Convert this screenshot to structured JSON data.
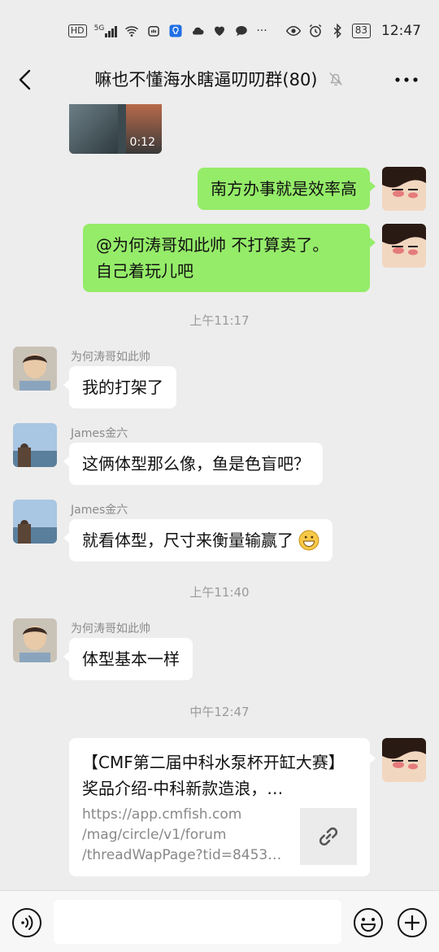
{
  "status_bar": {
    "network": "HD",
    "signal": "5G",
    "battery": "83",
    "time": "12:47"
  },
  "nav": {
    "title": "嘛也不懂海水瞎逼叨叨群(80)",
    "back_icon": "chevron-left-icon",
    "mute_icon": "bell-off-icon",
    "more_icon": "more-horizontal-icon"
  },
  "messages": {
    "video_duration": "0:12",
    "m1": "南方办事就是效率高",
    "m2_line1": "@为何涛哥如此帅  不打算卖了。",
    "m2_line2": "自己着玩儿吧",
    "ts1": "上午11:17",
    "s1": "为何涛哥如此帅",
    "m3": "我的打架了",
    "s2": "James金六",
    "m4": "这俩体型那么像，鱼是色盲吧？",
    "s3": "James金六",
    "m5": "就看体型，尺寸来衡量输赢了",
    "ts2": "上午11:40",
    "s4": "为何涛哥如此帅",
    "m6": "体型基本一样",
    "ts3": "中午12:47"
  },
  "link_card": {
    "title": "【CMF第二届中科水泵杯开缸大赛】奖品介绍-中科新款造浪，…",
    "desc_line1": "https://app.cmfish.com",
    "desc_line2": "/mag/circle/v1/forum",
    "desc_line3": "/threadWapPage?tid=8453…",
    "thumb_icon": "link-icon"
  },
  "input_bar": {
    "placeholder": "",
    "voice_icon": "voice-icon",
    "emoji_icon": "emoji-icon",
    "plus_icon": "plus-icon"
  },
  "colors": {
    "background": "#ededed",
    "my_bubble": "#95ec69",
    "their_bubble": "#ffffff",
    "timestamp": "#9a9a9a"
  }
}
